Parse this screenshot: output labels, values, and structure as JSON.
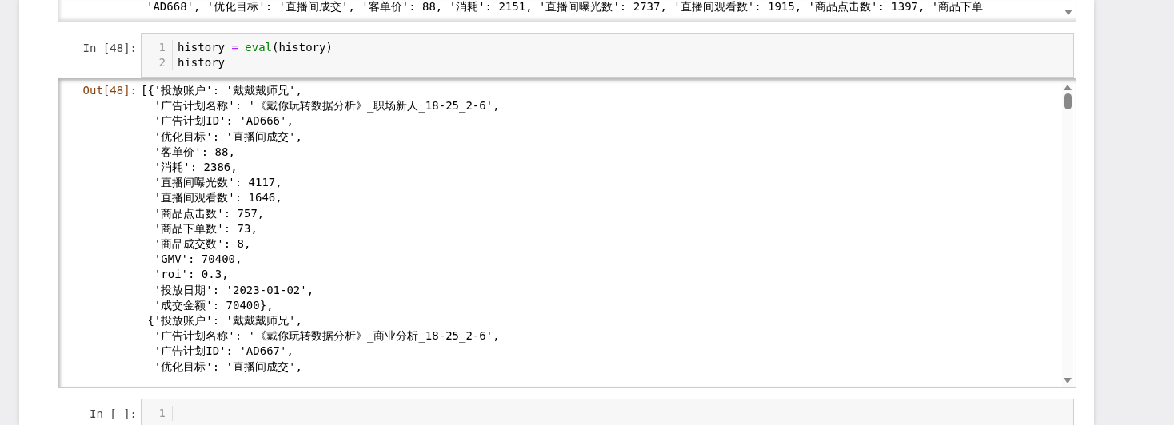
{
  "previous_output": {
    "lines": [
      "'AD668', '优化目标': '直播间成交', '客单价': 88, '消耗': 2151, '直播间曝光数': 2737, '直播间观看数': 1915, '商品点击数': 1397, '商品下单"
    ]
  },
  "cells": [
    {
      "kind": "code",
      "prompt": "In [48]:",
      "lines": [
        {
          "number": "1",
          "tokens": [
            {
              "text": "history ",
              "kind": "name"
            },
            {
              "text": "= ",
              "kind": "operator"
            },
            {
              "text": "eval",
              "kind": "builtin"
            },
            {
              "text": "(history)",
              "kind": "name"
            }
          ]
        },
        {
          "number": "2",
          "tokens": [
            {
              "text": "history",
              "kind": "name"
            }
          ]
        }
      ],
      "output": {
        "prompt": "Out[48]:",
        "lines": [
          "[{'投放账户': '戴戴戴师兄',",
          "  '广告计划名称': '《戴你玩转数据分析》_职场新人_18-25_2-6',",
          "  '广告计划ID': 'AD666',",
          "  '优化目标': '直播间成交',",
          "  '客单价': 88,",
          "  '消耗': 2386,",
          "  '直播间曝光数': 4117,",
          "  '直播间观看数': 1646,",
          "  '商品点击数': 757,",
          "  '商品下单数': 73,",
          "  '商品成交数': 8,",
          "  'GMV': 70400,",
          "  'roi': 0.3,",
          "  '投放日期': '2023-01-02',",
          "  '成交金额': 70400},",
          " {'投放账户': '戴戴戴师兄',",
          "  '广告计划名称': '《戴你玩转数据分析》_商业分析_18-25_2-6',",
          "  '广告计划ID': 'AD667',",
          "  '优化目标': '直播间成交',"
        ]
      }
    },
    {
      "kind": "code",
      "prompt": "In [ ]:",
      "lines": [
        {
          "number": "1"
        }
      ]
    }
  ]
}
